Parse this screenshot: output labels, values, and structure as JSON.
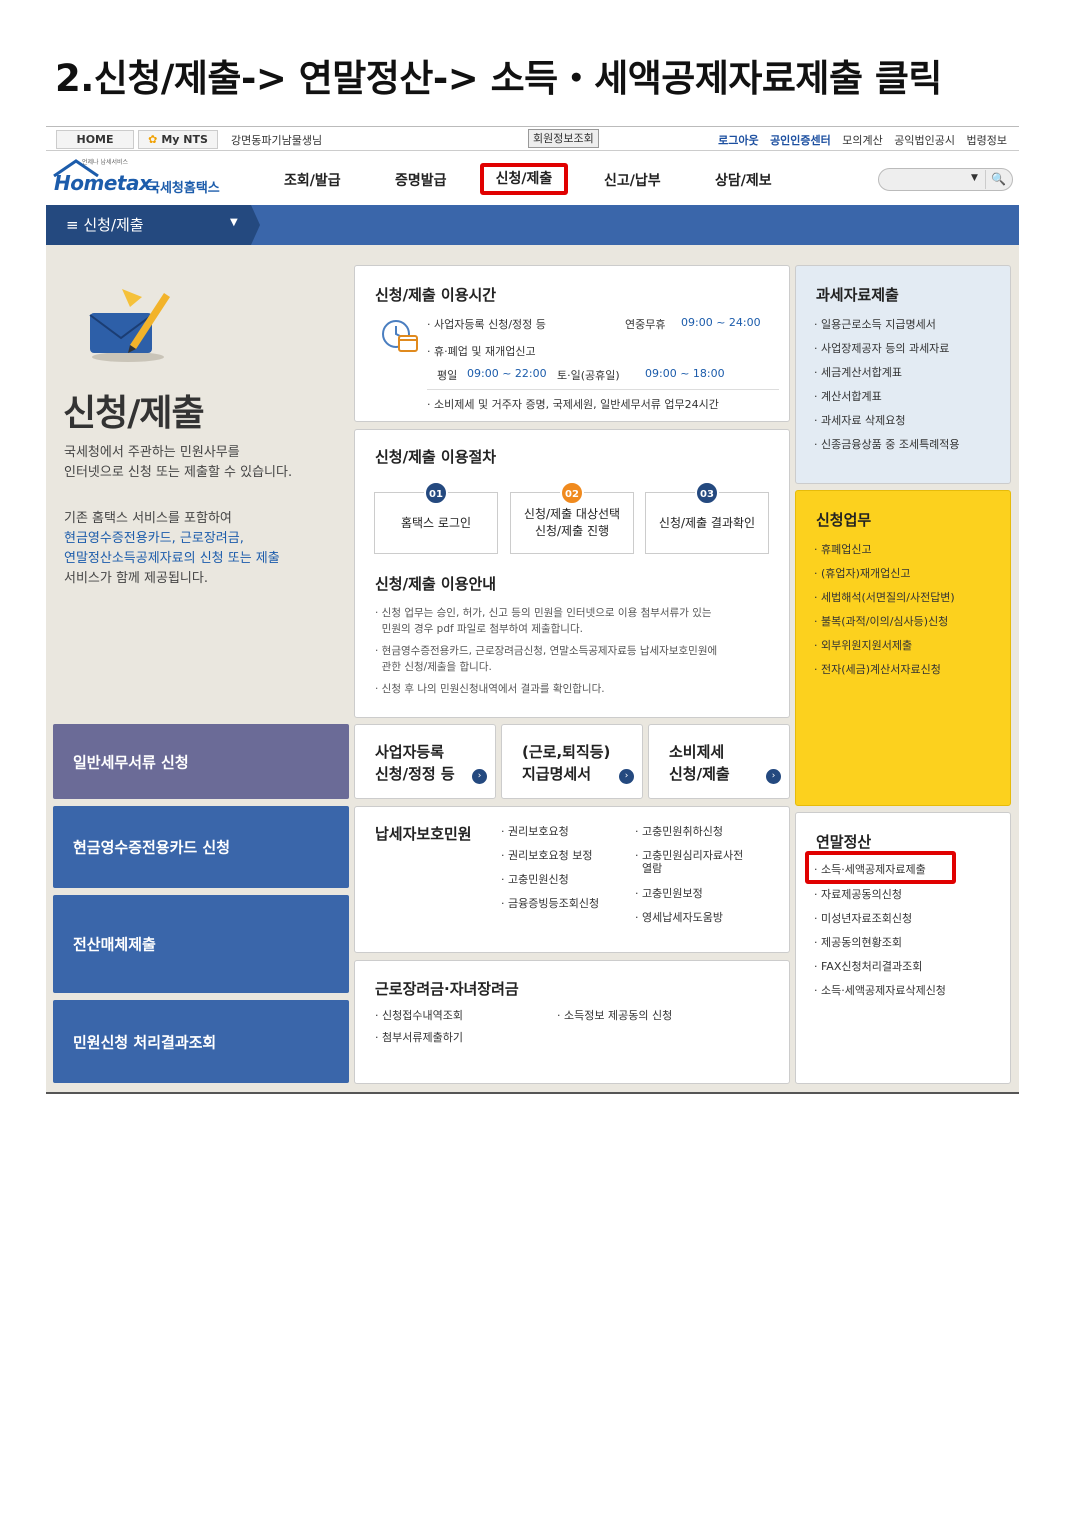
{
  "doc_title": "2.신청/제출-> 연말정산-> 소득・세액공제자료제출 클릭",
  "util": {
    "home": "HOME",
    "mynts": "My NTS",
    "user": "강면동파기남물생님",
    "member": "회원정보조회",
    "logout": "로그아웃",
    "cert": "공인인증센터",
    "links": [
      "모의계산",
      "공익법인공시",
      "법령정보"
    ]
  },
  "logo": {
    "small": "언제나 납세서비스",
    "brand": "Hometax.",
    "kr": "국세청홈택스"
  },
  "menu": [
    "조회/발급",
    "증명발급",
    "신청/제출",
    "신고/납부",
    "상담/제보"
  ],
  "bluebar": {
    "label": "신청/제출"
  },
  "hero": {
    "title": "신청/제출",
    "desc": [
      "국세청에서 주관하는 민원사무를",
      "인터넷으로 신청 또는 제출할 수 있습니다."
    ],
    "desc2_plain1": "기존 홈택스 서비스를 포함하여",
    "desc2_blue1": "현금영수증전용카드, 근로장려금,",
    "desc2_blue2": "연말정산소득공제자료의 신청 또는 제출",
    "desc2_plain2": "서비스가 함께 제공됩니다."
  },
  "left_buttons": [
    "일반세무서류 신청",
    "현금영수증전용카드 신청",
    "전산매체제출",
    "민원신청 처리결과조회"
  ],
  "hours": {
    "title": "신청/제출 이용시간",
    "l1a": "· 사업자등록 신청/정정 등",
    "l1b": "연중무휴",
    "l1c": "09:00 ~ 24:00",
    "l2": "· 휴·폐업 및 재개업신고",
    "l3a": "평일",
    "l3b": "09:00 ~ 22:00",
    "l3c": "토·일(공휴일)",
    "l3d": "09:00 ~ 18:00",
    "l4": "· 소비제세 및 거주자 증명, 국제세원, 일반세무서류 업무24시간"
  },
  "procedure": {
    "title": "신청/제출 이용절차",
    "steps": [
      {
        "num": "01",
        "text": "홈택스 로그인"
      },
      {
        "num": "02",
        "text": "신청/제출 대상선택\n신청/제출 진행"
      },
      {
        "num": "03",
        "text": "신청/제출 결과확인"
      }
    ],
    "guide_title": "신청/제출 이용안내",
    "guide": [
      "· 신청 업무는 승인, 허가, 신고 등의 민원을 인터넷으로 이용 첨부서류가 있는",
      "  민원의 경우 pdf 파일로 첨부하여 제출합니다.",
      "· 현금영수증전용카드, 근로장려금신청, 연말소득공제자료등 납세자보호민원에",
      "  관한 신청/제출을 합니다.",
      "· 신청 후 나의 민원신청내역에서 결과를 확인합니다."
    ]
  },
  "minis": [
    {
      "text": "사업자등록\n신청/정정 등"
    },
    {
      "text": "(근로,퇴직등)\n지급명세서"
    },
    {
      "text": "소비제세\n신청/제출"
    }
  ],
  "taxpayer": {
    "title": "납세자보호민원",
    "col1": [
      "· 권리보호요청",
      "· 권리보호요청 보정",
      "· 고충민원신청",
      "· 금융증빙등조회신청"
    ],
    "col2": [
      "· 고충민원취하신청",
      "· 고충민원심리자료사전",
      "  열람",
      "· 고충민원보정",
      "· 영세납세자도움방"
    ]
  },
  "eitc": {
    "title": "근로장려금·자녀장려금",
    "items": [
      "· 신청접수내역조회",
      "· 소득정보 제공동의 신청",
      "· 첨부서류제출하기"
    ]
  },
  "taxdata": {
    "title": "과세자료제출",
    "items": [
      "· 일용근로소득 지급명세서",
      "· 사업장제공자 등의 과세자료",
      "· 세금계산서합계표",
      "· 계산서합계표",
      "· 과세자료 삭제요청",
      "· 신종금융상품 중 조세특례적용"
    ]
  },
  "apply": {
    "title": "신청업무",
    "items": [
      "· 휴폐업신고",
      "· (휴업자)재개업신고",
      "· 세법해석(서면질의/사전답변)",
      "· 불복(과적/이의/심사등)신청",
      "· 외부위원지원서제출",
      "· 전자(세금)계산서자료신청"
    ]
  },
  "yearend": {
    "title": "연말정산",
    "items": [
      "· 소득·세액공제자료제출",
      "· 자료제공동의신청",
      "· 미성년자료조회신청",
      "· 제공동의현황조회",
      "· FAX신청처리결과조회",
      "· 소득·세액공제자료삭제신청"
    ]
  },
  "colors": {
    "red": "#e00000",
    "navy": "#24497f",
    "blue": "#3a66aa",
    "yellow": "#fcd11e",
    "lightblue": "#e3ebf3",
    "purple": "#6b6b97"
  },
  "icons": [
    "star-icon",
    "search-icon",
    "menu-icon",
    "caret-down-icon",
    "clock-calendar-icon",
    "envelope-pencil-icon",
    "arrow-circle-icon"
  ]
}
